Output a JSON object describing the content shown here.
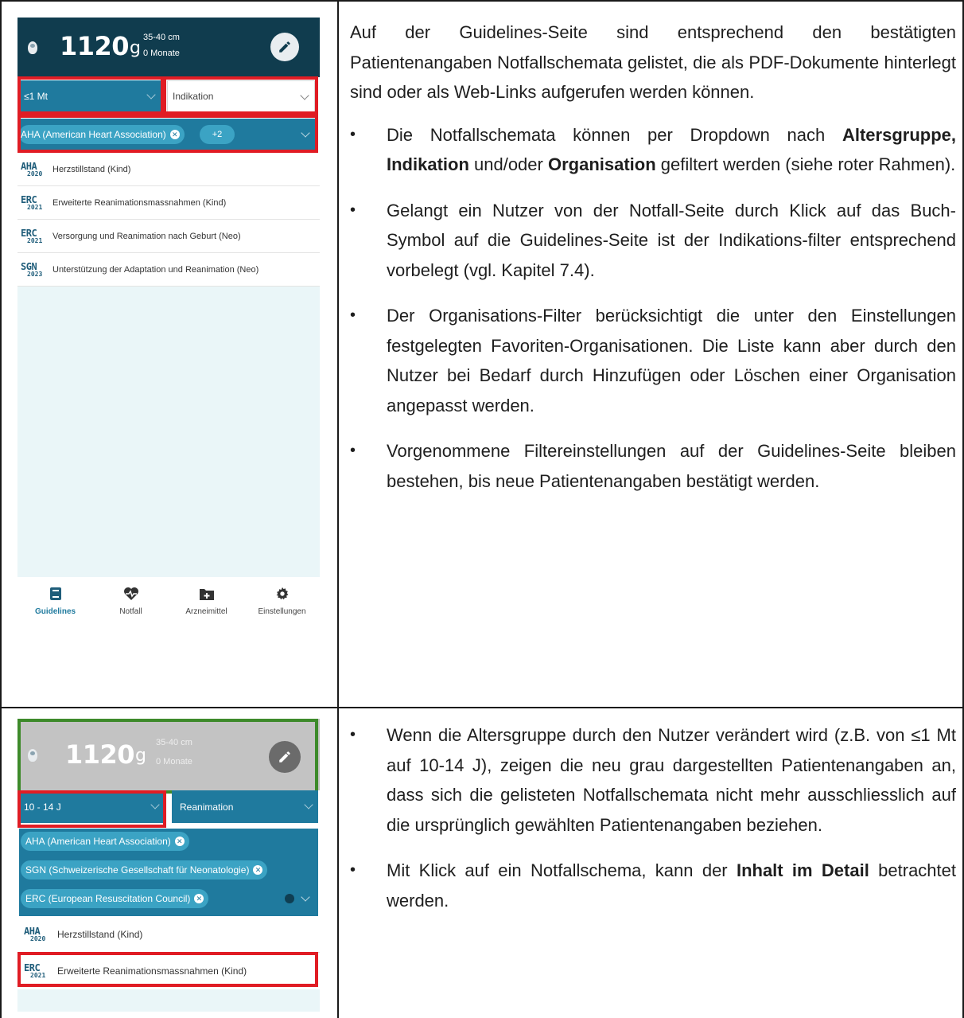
{
  "screen1": {
    "weight_value": "1120",
    "weight_unit": "g",
    "length": "35-40 cm",
    "age": "0 Monate",
    "age_filter": "≤1 Mt",
    "indication_filter": "Indikation",
    "org_chip": "AHA (American Heart Association)",
    "more_chip": "+2",
    "guidelines": [
      {
        "org": "AHA",
        "year": "2020",
        "title": "Herzstillstand (Kind)"
      },
      {
        "org": "ERC",
        "year": "2021",
        "title": "Erweiterte Reanimationsmassnahmen (Kind)"
      },
      {
        "org": "ERC",
        "year": "2021",
        "title": "Versorgung und Reanimation nach Geburt (Neo)"
      },
      {
        "org": "SGN",
        "year": "2023",
        "title": "Unterstützung der Adaptation und Reanimation (Neo)"
      }
    ],
    "tabs": [
      {
        "label": "Guidelines",
        "icon": "book-icon"
      },
      {
        "label": "Notfall",
        "icon": "heartbeat-icon"
      },
      {
        "label": "Arzneimittel",
        "icon": "medicine-folder-icon"
      },
      {
        "label": "Einstellungen",
        "icon": "gear-icon"
      }
    ]
  },
  "screen2": {
    "weight_value": "1120",
    "weight_unit": "g",
    "length": "35-40 cm",
    "age": "0 Monate",
    "age_filter": "10 - 14 J",
    "indication_filter": "Reanimation",
    "org_chips": [
      "AHA (American Heart Association)",
      "SGN (Schweizerische Gesellschaft für Neonatologie)",
      "ERC (European Resuscitation Council)"
    ],
    "guidelines": [
      {
        "org": "AHA",
        "year": "2020",
        "title": "Herzstillstand (Kind)"
      },
      {
        "org": "ERC",
        "year": "2021",
        "title": "Erweiterte Reanimationsmassnahmen (Kind)"
      }
    ]
  },
  "text1": {
    "intro": "Auf der Guidelines-Seite sind entsprechend den bestätigten Patientenangaben Notfallschemata gelistet, die als PDF-Dokumente hinterlegt sind oder als Web-Links aufgerufen werden können.",
    "b1_pre": "Die Notfallschemata können per Dropdown nach ",
    "b1_bold1": "Altersgruppe, Indikation",
    "b1_mid": " und/oder ",
    "b1_bold2": "Organisation",
    "b1_post": " gefiltert werden (siehe roter Rahmen).",
    "b2": "Gelangt ein Nutzer von der Notfall-Seite durch Klick auf das Buch-Symbol auf die Guidelines-Seite ist der Indikations-filter entsprechend vorbelegt (vgl. Kapitel 7.4).",
    "b3": "Der Organisations-Filter berücksichtigt die unter den Einstellungen festgelegten Favoriten-Organisationen. Die Liste kann aber durch den Nutzer bei Bedarf durch Hinzufügen oder Löschen einer Organisation angepasst werden.",
    "b4": "Vorgenommene Filtereinstellungen auf der Guidelines-Seite bleiben bestehen, bis neue Patientenangaben bestätigt werden."
  },
  "text2": {
    "b1": "Wenn die Altersgruppe durch den Nutzer verändert wird (z.B. von ≤1 Mt auf 10-14 J), zeigen die neu grau dargestellten Patientenangaben an, dass sich die gelisteten Notfallschemata nicht mehr ausschliesslich auf die ursprünglich gewählten Patientenangaben beziehen.",
    "b2_pre": "Mit Klick auf ein Notfallschema, kann der ",
    "b2_bold": "Inhalt im Detail",
    "b2_post": " betrachtet werden."
  },
  "colors": {
    "header_dark": "#103c4e",
    "filter_blue": "#1f7a9e",
    "chip_blue": "#3ba3c4",
    "highlight_red": "#e01c24",
    "highlight_green": "#3d8a2a",
    "header_grey": "#c3c3c3"
  }
}
